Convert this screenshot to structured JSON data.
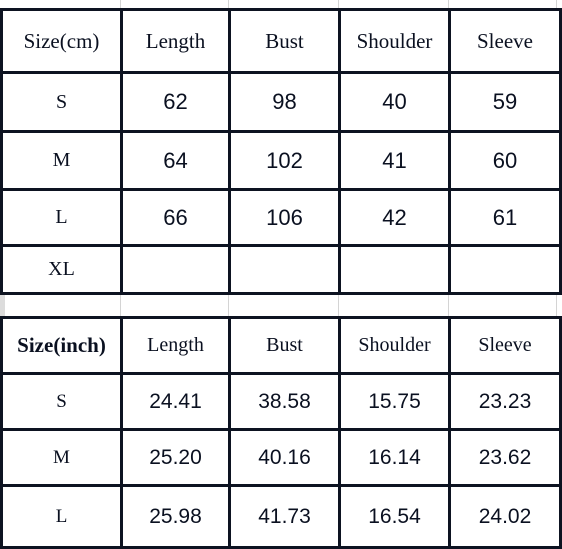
{
  "tables": [
    {
      "id": "cm",
      "unit_label": "Size(cm)",
      "columns": [
        "Length",
        "Bust",
        "Shoulder",
        "Sleeve"
      ],
      "rows": [
        {
          "size": "S",
          "values": [
            "62",
            "98",
            "40",
            "59"
          ]
        },
        {
          "size": "M",
          "values": [
            "64",
            "102",
            "41",
            "60"
          ]
        },
        {
          "size": "L",
          "values": [
            "66",
            "106",
            "42",
            "61"
          ]
        },
        {
          "size": "XL",
          "values": [
            "",
            "",
            "",
            ""
          ]
        }
      ]
    },
    {
      "id": "inch",
      "unit_label": "Size(inch)",
      "columns": [
        "Length",
        "Bust",
        "Shoulder",
        "Sleeve"
      ],
      "rows": [
        {
          "size": "S",
          "values": [
            "24.41",
            "38.58",
            "15.75",
            "23.23"
          ]
        },
        {
          "size": "M",
          "values": [
            "25.20",
            "40.16",
            "16.14",
            "23.62"
          ]
        },
        {
          "size": "L",
          "values": [
            "25.98",
            "41.73",
            "16.54",
            "24.02"
          ]
        }
      ]
    }
  ],
  "colors": {
    "header_blue": "#9DC6F5",
    "border": "#0D1321",
    "cell_white": "#FFFFFF",
    "row_marker_peach": "#E0B08A"
  }
}
